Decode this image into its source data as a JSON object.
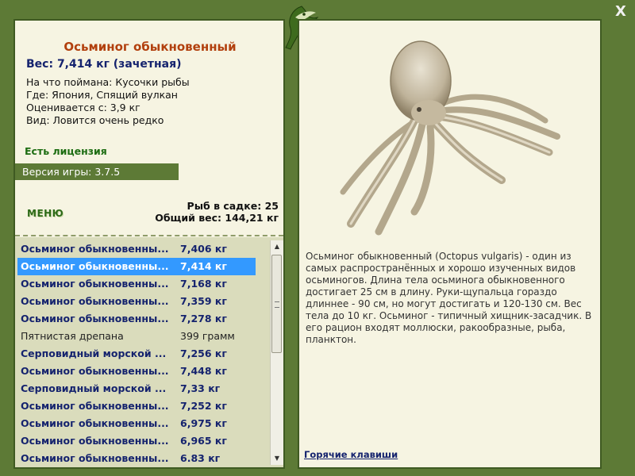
{
  "fish": {
    "title": "Осьминог обыкновенный",
    "weight": "Вес: 7,414 кг (зачетная)",
    "caught_on": "На что поймана: Кусочки рыбы",
    "location": "Где: Япония, Спящий вулкан",
    "rated_from": "Оценивается с: 3,9 кг",
    "rarity": "Вид: Ловится очень редко"
  },
  "license": "Есть лицензия",
  "version": "Версия игры: 3.7.5",
  "menu_label": "МЕНЮ",
  "stats": {
    "fish_in_net": "Рыб в садке: 25",
    "total_weight": "Общий вес: 144,21 кг"
  },
  "catch_list": [
    {
      "name": "Осьминог обыкновенны...",
      "weight": "7,406 кг",
      "style": "blue"
    },
    {
      "name": "Осьминог обыкновенны...",
      "weight": "7,414 кг",
      "style": "sel"
    },
    {
      "name": "Осьминог обыкновенны...",
      "weight": "7,168 кг",
      "style": "blue"
    },
    {
      "name": "Осьминог обыкновенны...",
      "weight": "7,359 кг",
      "style": "blue"
    },
    {
      "name": "Осьминог обыкновенны...",
      "weight": "7,278 кг",
      "style": "blue"
    },
    {
      "name": "Пятнистая дрепана",
      "weight": "399 грамм",
      "style": "plain"
    },
    {
      "name": "Серповидный морской ...",
      "weight": "7,256 кг",
      "style": "blue"
    },
    {
      "name": "Осьминог обыкновенны...",
      "weight": "7,448 кг",
      "style": "blue"
    },
    {
      "name": "Серповидный морской ...",
      "weight": "7,33 кг",
      "style": "blue"
    },
    {
      "name": "Осьминог обыкновенны...",
      "weight": "7,252 кг",
      "style": "blue"
    },
    {
      "name": "Осьминог обыкновенны...",
      "weight": "6,975 кг",
      "style": "blue"
    },
    {
      "name": "Осьминог обыкновенны...",
      "weight": "6,965 кг",
      "style": "blue"
    },
    {
      "name": "Осьминог обыкновенны...",
      "weight": "6.83 кг",
      "style": "blue"
    }
  ],
  "description": "Осьминог обыкновенный (Octopus vulgaris) - один из самых распространённых и хорошо изученных видов осьминогов. Длина тела осьминога обыкновенного достигает 25 см в длину. Руки-щупальца гораздо длиннее - 90 см, но могут достигать и 120-130 см. Вес тела до 10 кг. Осьминог - типичный хищник-засадчик. В его рацион входят моллюски, ракообразные, рыба, планктон.",
  "hotkeys": "Горячие клавиши",
  "close_symbol": "X",
  "icons": {
    "close": "close-icon",
    "logo": "fish-logo-icon",
    "scroll_up": "arrow-up-icon",
    "scroll_down": "arrow-down-icon"
  },
  "colors": {
    "frame": "#5d7a36",
    "panel": "#f6f4e2",
    "title": "#b2400e",
    "list_text": "#15236e",
    "selection": "#3399ff",
    "license": "#1d6d12"
  }
}
